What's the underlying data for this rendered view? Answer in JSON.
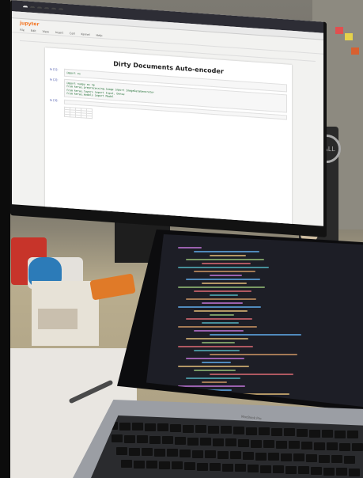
{
  "scene": {
    "description_tags": [
      "monitor",
      "laptop",
      "desk",
      "keyboard"
    ],
    "colors": {
      "wall": "#7d7a72",
      "desk": "#b9ad8e",
      "code_bg": "#1d1e26",
      "jupyter_orange": "#f37726"
    }
  },
  "monitor": {
    "brand": "D&LL",
    "browser_tabs": [
      "",
      "",
      "",
      "",
      "",
      ""
    ],
    "notebook": {
      "app": "jupyter",
      "title": "",
      "menus": [
        "File",
        "Edit",
        "View",
        "Insert",
        "Cell",
        "Kernel",
        "Help"
      ],
      "heading": "Dirty Documents Auto-encoder",
      "cells": [
        {
          "prompt": "In [1]:",
          "lines": [
            "import os",
            ""
          ]
        },
        {
          "prompt": "In [2]:",
          "lines": [
            "import numpy as np",
            "from keras.preprocessing.image import ImageDataGenerator",
            "from keras.layers import Input, Dense",
            "from keras.models import Model",
            "",
            ""
          ]
        },
        {
          "prompt": "In [3]:",
          "lines": [
            "",
            ""
          ]
        }
      ]
    }
  },
  "laptop": {
    "brand": "MacBook Pro"
  }
}
